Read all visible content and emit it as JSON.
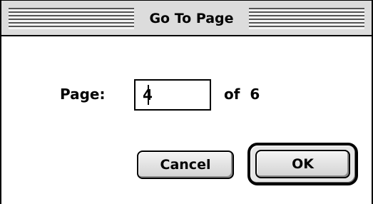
{
  "dialog": {
    "title": "Go To Page",
    "page_label": "Page:",
    "page_input": {
      "value": "4"
    },
    "of_label": "of",
    "total_pages": "6",
    "cancel_label": "Cancel",
    "ok_label": "OK",
    "default_button": "OK"
  }
}
